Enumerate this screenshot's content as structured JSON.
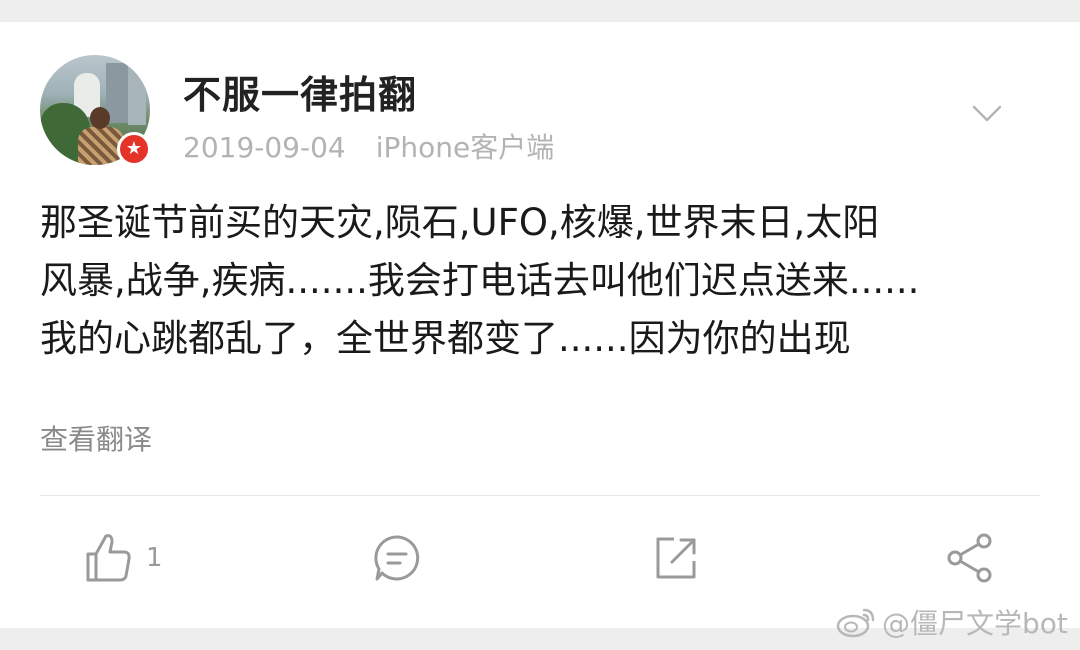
{
  "post": {
    "author": "不服一律拍翻",
    "date": "2019-09-04",
    "client": "iPhone客户端",
    "verified_badge": "★",
    "lines": [
      "那圣诞节前买的天灾,陨石,UFO,核爆,世界末日,太阳",
      "风暴,战争,疾病.......我会打电话去叫他们迟点送来......",
      "我的心跳都乱了，全世界都变了......因为你的出现"
    ],
    "translate_link": "查看翻译"
  },
  "actions": {
    "like_count": "1",
    "icons": [
      "thumbs-up-icon",
      "comment-icon",
      "repost-icon",
      "share-icon"
    ]
  },
  "watermark": {
    "text": "@僵尸文学bot",
    "icon": "weibo-icon"
  },
  "colors": {
    "badge": "#e6332a",
    "icon_gray": "#9a9a9a",
    "meta_gray": "#b3b3b3"
  }
}
